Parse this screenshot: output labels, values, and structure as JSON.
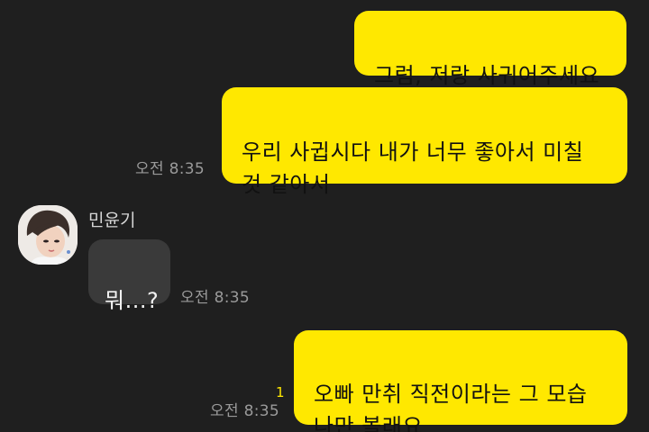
{
  "messages": [
    {
      "sender": "me",
      "text": "그럼, 저랑 사귀어주세요"
    },
    {
      "sender": "me",
      "text": "우리 사귑시다 내가 너무 좋아서 미칠\n것 같아서",
      "time": "오전 8:35"
    },
    {
      "sender": "민윤기",
      "text": "뭐...?",
      "time": "오전 8:35"
    },
    {
      "sender": "me",
      "text": "오빠 만취 직전이라는 그 모습\n나만 볼래요",
      "time": "오전 8:35",
      "unread": "1"
    }
  ],
  "contact": {
    "name": "민윤기",
    "avatar_icon": "profile-photo-icon"
  },
  "colors": {
    "background": "#1f1f1f",
    "my_bubble": "#ffe800",
    "their_bubble": "#3a3a3a",
    "time_text": "#9a9a9a",
    "unread_count": "#ffe800"
  }
}
